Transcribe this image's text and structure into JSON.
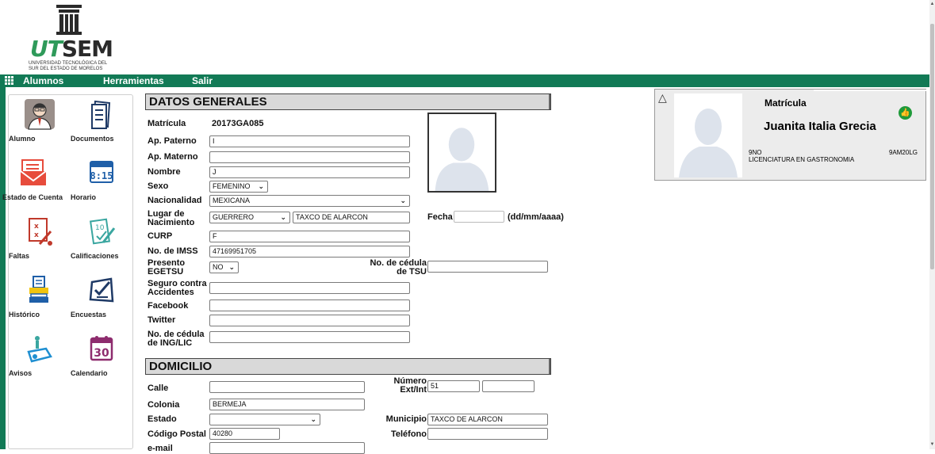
{
  "logo": {
    "brand_ut": "UT",
    "brand_sem": "SEM",
    "subtitle_line1": "UNIVERSIDAD TECNOLÓGICA DEL",
    "subtitle_line2": "SUR DEL ESTADO DE MORELOS"
  },
  "nav": {
    "alumnos": "Alumnos",
    "herramientas": "Herramientas",
    "salir": "Salir"
  },
  "sidebar": {
    "items": [
      {
        "label": "Alumno",
        "icon": "student-icon"
      },
      {
        "label": "Documentos",
        "icon": "documents-icon"
      },
      {
        "label": "Estado de Cuenta",
        "icon": "account-statement-icon"
      },
      {
        "label": "Horario",
        "icon": "schedule-icon"
      },
      {
        "label": "Faltas",
        "icon": "absences-icon"
      },
      {
        "label": "Calificaciones",
        "icon": "grades-icon"
      },
      {
        "label": "Histórico",
        "icon": "history-icon"
      },
      {
        "label": "Encuestas",
        "icon": "surveys-icon"
      },
      {
        "label": "Avisos",
        "icon": "notices-icon"
      },
      {
        "label": "Calendario",
        "icon": "calendar-icon"
      }
    ]
  },
  "general": {
    "title": "DATOS GENERALES",
    "matricula_label": "Matrícula",
    "matricula_value": "20173GA085",
    "ap_paterno_label": "Ap. Paterno",
    "ap_paterno_value": "I",
    "ap_materno_label": "Ap. Materno",
    "ap_materno_value": "",
    "nombre_label": "Nombre",
    "nombre_value": "J",
    "sexo_label": "Sexo",
    "sexo_value": "FEMENINO",
    "nacionalidad_label": "Nacionalidad",
    "nacionalidad_value": "MEXICANA",
    "lugar_label_1": "Lugar de",
    "lugar_label_2": "Nacimiento",
    "lugar_estado_value": "GUERRERO",
    "lugar_municipio_value": "TAXCO DE ALARCON",
    "fecha_label": "Fecha",
    "fecha_value": "",
    "fecha_hint": "(dd/mm/aaaa)",
    "curp_label": "CURP",
    "curp_value": "F",
    "imss_label": "No. de IMSS",
    "imss_value": "47169951705",
    "egetsu_label_1": "Presento",
    "egetsu_label_2": "EGETSU",
    "egetsu_value": "NO",
    "cedula_tsu_label_1": "No. de cédula",
    "cedula_tsu_label_2": "de TSU",
    "cedula_tsu_value": "",
    "seguro_label_1": "Seguro contra",
    "seguro_label_2": "Accidentes",
    "seguro_value": "",
    "facebook_label": "Facebook",
    "facebook_value": "",
    "twitter_label": "Twitter",
    "twitter_value": "",
    "cedula_ing_label_1": "No. de cédula",
    "cedula_ing_label_2": "de ING/LIC",
    "cedula_ing_value": ""
  },
  "domicilio": {
    "title": "DOMICILIO",
    "calle_label": "Calle",
    "calle_value": "",
    "numero_label_1": "Número",
    "numero_label_2": "Ext/Int",
    "numero_ext_value": "51",
    "numero_int_value": "",
    "colonia_label": "Colonia",
    "colonia_value": "BERMEJA",
    "estado_label": "Estado",
    "estado_value": "",
    "municipio_label": "Municipio",
    "municipio_value": "TAXCO DE ALARCON",
    "cp_label": "Código Postal",
    "cp_value": "40280",
    "telefono_label": "Teléfono",
    "telefono_value": "",
    "email_label": "e-mail",
    "email_value": ""
  },
  "card": {
    "matricula_label": "Matrícula",
    "name": "Juanita Italia Grecia",
    "grade": "9NO",
    "career": "LICENCIATURA EN GASTRONOMIA",
    "group": "9AM20LG"
  },
  "colors": {
    "nav_green": "#127a56",
    "section_gray": "#d9d9d9",
    "card_gray": "#ececec",
    "ok_green": "#1f9a3a"
  }
}
